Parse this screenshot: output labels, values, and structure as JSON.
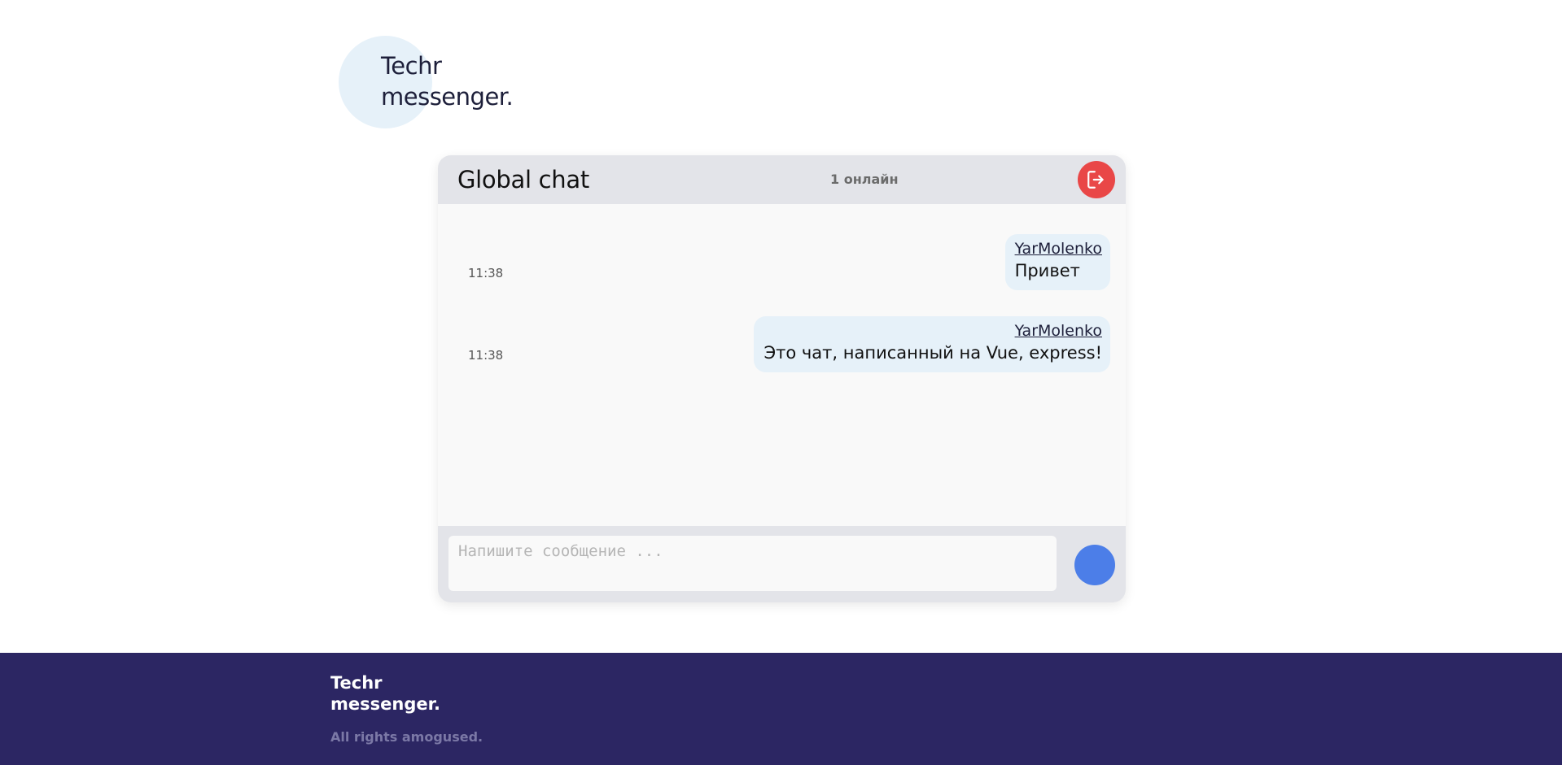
{
  "logo": {
    "line1": "Techr",
    "line2": "messenger."
  },
  "chat": {
    "title": "Global chat",
    "online": "1 онлайн",
    "logout_icon": "logout-icon",
    "messages": [
      {
        "author": "YarMolenko",
        "text": "Привет",
        "time": "11:38"
      },
      {
        "author": "YarMolenko",
        "text": "Это чат, написанный на Vue, express!",
        "time": "11:38"
      }
    ],
    "input": {
      "value": "",
      "placeholder": "Напишите сообщение ..."
    }
  },
  "footer": {
    "logo_line1": "Techr",
    "logo_line2": "messenger.",
    "copyright": "All rights amogused."
  },
  "colors": {
    "logo_circle": "#e6f1f9",
    "header_bg": "#e3e4e9",
    "logout": "#e94747",
    "send": "#4c7ee8",
    "bubble": "#e6f1f9",
    "footer_bg": "#2c2663"
  }
}
